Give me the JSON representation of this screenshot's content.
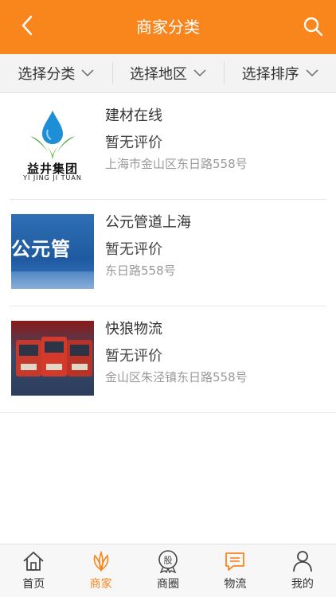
{
  "header": {
    "title": "商家分类",
    "back_icon": "back-arrow-icon",
    "search_icon": "search-icon",
    "color": "#f8861d"
  },
  "filters": [
    {
      "label": "选择分类"
    },
    {
      "label": "选择地区"
    },
    {
      "label": "选择排序"
    }
  ],
  "merchants": [
    {
      "name": "建材在线",
      "rating": "暂无评价",
      "address": "上海市金山区东日路558号",
      "logo_text": "益井集团",
      "logo_subtext": "YI  JING JI TUAN"
    },
    {
      "name": "公元管道上海",
      "rating": "暂无评价",
      "address": "东日路558号",
      "logo_text": "公元管"
    },
    {
      "name": "快狼物流",
      "rating": "暂无评价",
      "address": "金山区朱泾镇东日路558号"
    }
  ],
  "tabbar": {
    "items": [
      {
        "label": "首页",
        "icon": "home-icon"
      },
      {
        "label": "商家",
        "icon": "merchant-icon"
      },
      {
        "label": "商圈",
        "icon": "stock-circle-icon",
        "icon_text": "股"
      },
      {
        "label": "物流",
        "icon": "chat-logistics-icon"
      },
      {
        "label": "我的",
        "icon": "user-icon"
      }
    ],
    "active_color": "#f8861d"
  }
}
